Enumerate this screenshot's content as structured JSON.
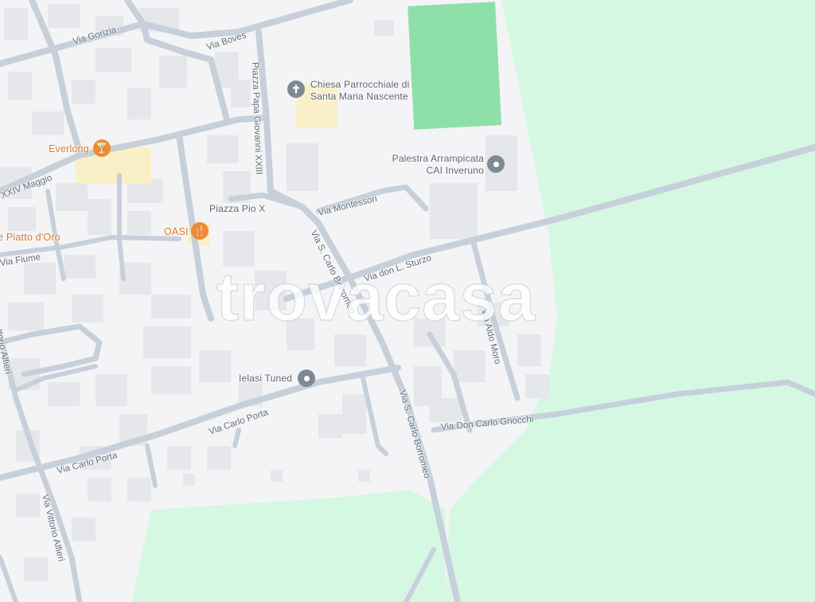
{
  "map": {
    "colors": {
      "background": "#f4f4f6",
      "green_area": "#d5f8e3",
      "sports_field": "#8fe0a8",
      "road": "#c7d0da",
      "building": "#e6e7ea",
      "poi_orange": "#ee8a2f",
      "poi_grey": "#7d8a96"
    },
    "watermark": "trovacasa",
    "places": {
      "church": {
        "line1": "Chiesa Parrocchiale di",
        "line2": "Santa Maria Nascente",
        "icon": "church-icon"
      },
      "gym": {
        "line1": "Palestra Arrampicata",
        "line2": "CAI Inveruno",
        "icon": "pin-icon"
      },
      "everlong": {
        "label": "Everlong",
        "icon": "cocktail-icon"
      },
      "oasi": {
        "label": "OASI",
        "icon": "restaurant-icon"
      },
      "piazza_pio": {
        "label": "Piazza Pio X"
      },
      "ielasi": {
        "label": "Ielasi Tuned",
        "icon": "pin-icon"
      },
      "piatto": {
        "label": "e Piatto d'Oro"
      }
    },
    "roads": {
      "gorizia": "Via Gorizia",
      "boves": "Via Boves",
      "papa": "Piazza Papa Giovanni XXIII",
      "maggio": "XXIV Maggio",
      "montessori": "Via Montessori",
      "fiume": "Via Fiume",
      "borromeo1": "Via S. Carlo Borromeo",
      "sturzo": "Via don L. Sturzo",
      "aldo_moro": "Via Aldo Moro",
      "alfieri1": "ttorio Alfieri",
      "carlo_porta1": "Via Carlo Porta",
      "carlo_porta2": "Via Carlo Porta",
      "borromeo2": "Via S. Carlo Borromeo",
      "gnocchi": "Via Don Carlo Gnocchi",
      "alfieri2": "Via Vittorio Alfieri"
    }
  }
}
